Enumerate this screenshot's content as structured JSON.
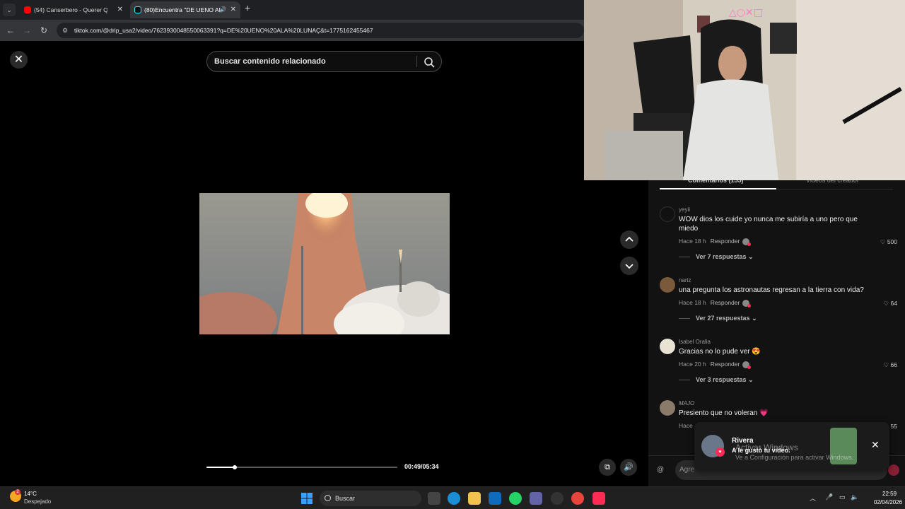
{
  "browser": {
    "tabs": [
      {
        "title": "(54) Canserbero - Querer Quer",
        "favicon": "youtube-icon",
        "active": false
      },
      {
        "title": "(80)Encuentra \"DE UENO AL",
        "favicon": "tiktok-icon",
        "active": true
      }
    ],
    "url": "tiktok.com/@drip_usa2/video/7623930048550063391?q=DE%20UENO%20ALA%20LUNAÇ&t=1775162455467"
  },
  "search": {
    "placeholder": "Buscar contenido relacionado"
  },
  "player": {
    "time": "00:49/05:34",
    "progress": 0.147
  },
  "comments_tabs": [
    "Comentarios (155)",
    "Videos del creador"
  ],
  "comments": [
    {
      "user": "yeyii",
      "text": "WOW dios los cuide yo nunca me subiría a uno pero que miedo",
      "time": "Hace 18 h",
      "reply": "Responder",
      "likes": "500",
      "more": "Ver 7 respuestas"
    },
    {
      "user": "nariz",
      "text": "una pregunta los astronautas regresan a la tierra con vida?",
      "time": "Hace 18 h",
      "reply": "Responder",
      "likes": "64",
      "more": "Ver 27 respuestas"
    },
    {
      "user": "Isabel Oralia",
      "text": "Gracias no lo pude ver 😍",
      "time": "Hace 20 h",
      "reply": "Responder",
      "likes": "66",
      "more": "Ver 3 respuestas"
    },
    {
      "user": "MAJO",
      "text": "Presiento que no voleran 💗",
      "time": "Hace",
      "reply": "",
      "likes": "55",
      "more": ""
    }
  ],
  "comment_input": {
    "placeholder": "Agre"
  },
  "toast": {
    "name": "Rivera",
    "message": "A le gustó tu video."
  },
  "watermark": {
    "line1": "Activar Windows",
    "line2": "Ve a Configuración para activar Windows."
  },
  "taskbar": {
    "temp": "14°C",
    "weather": "Despejado",
    "weather_badge": "2",
    "search": "Buscar",
    "time": "22:59",
    "date": "02/04/2026"
  },
  "colors": {
    "tiktok_red": "#fe2c55",
    "panel": "#121212"
  }
}
